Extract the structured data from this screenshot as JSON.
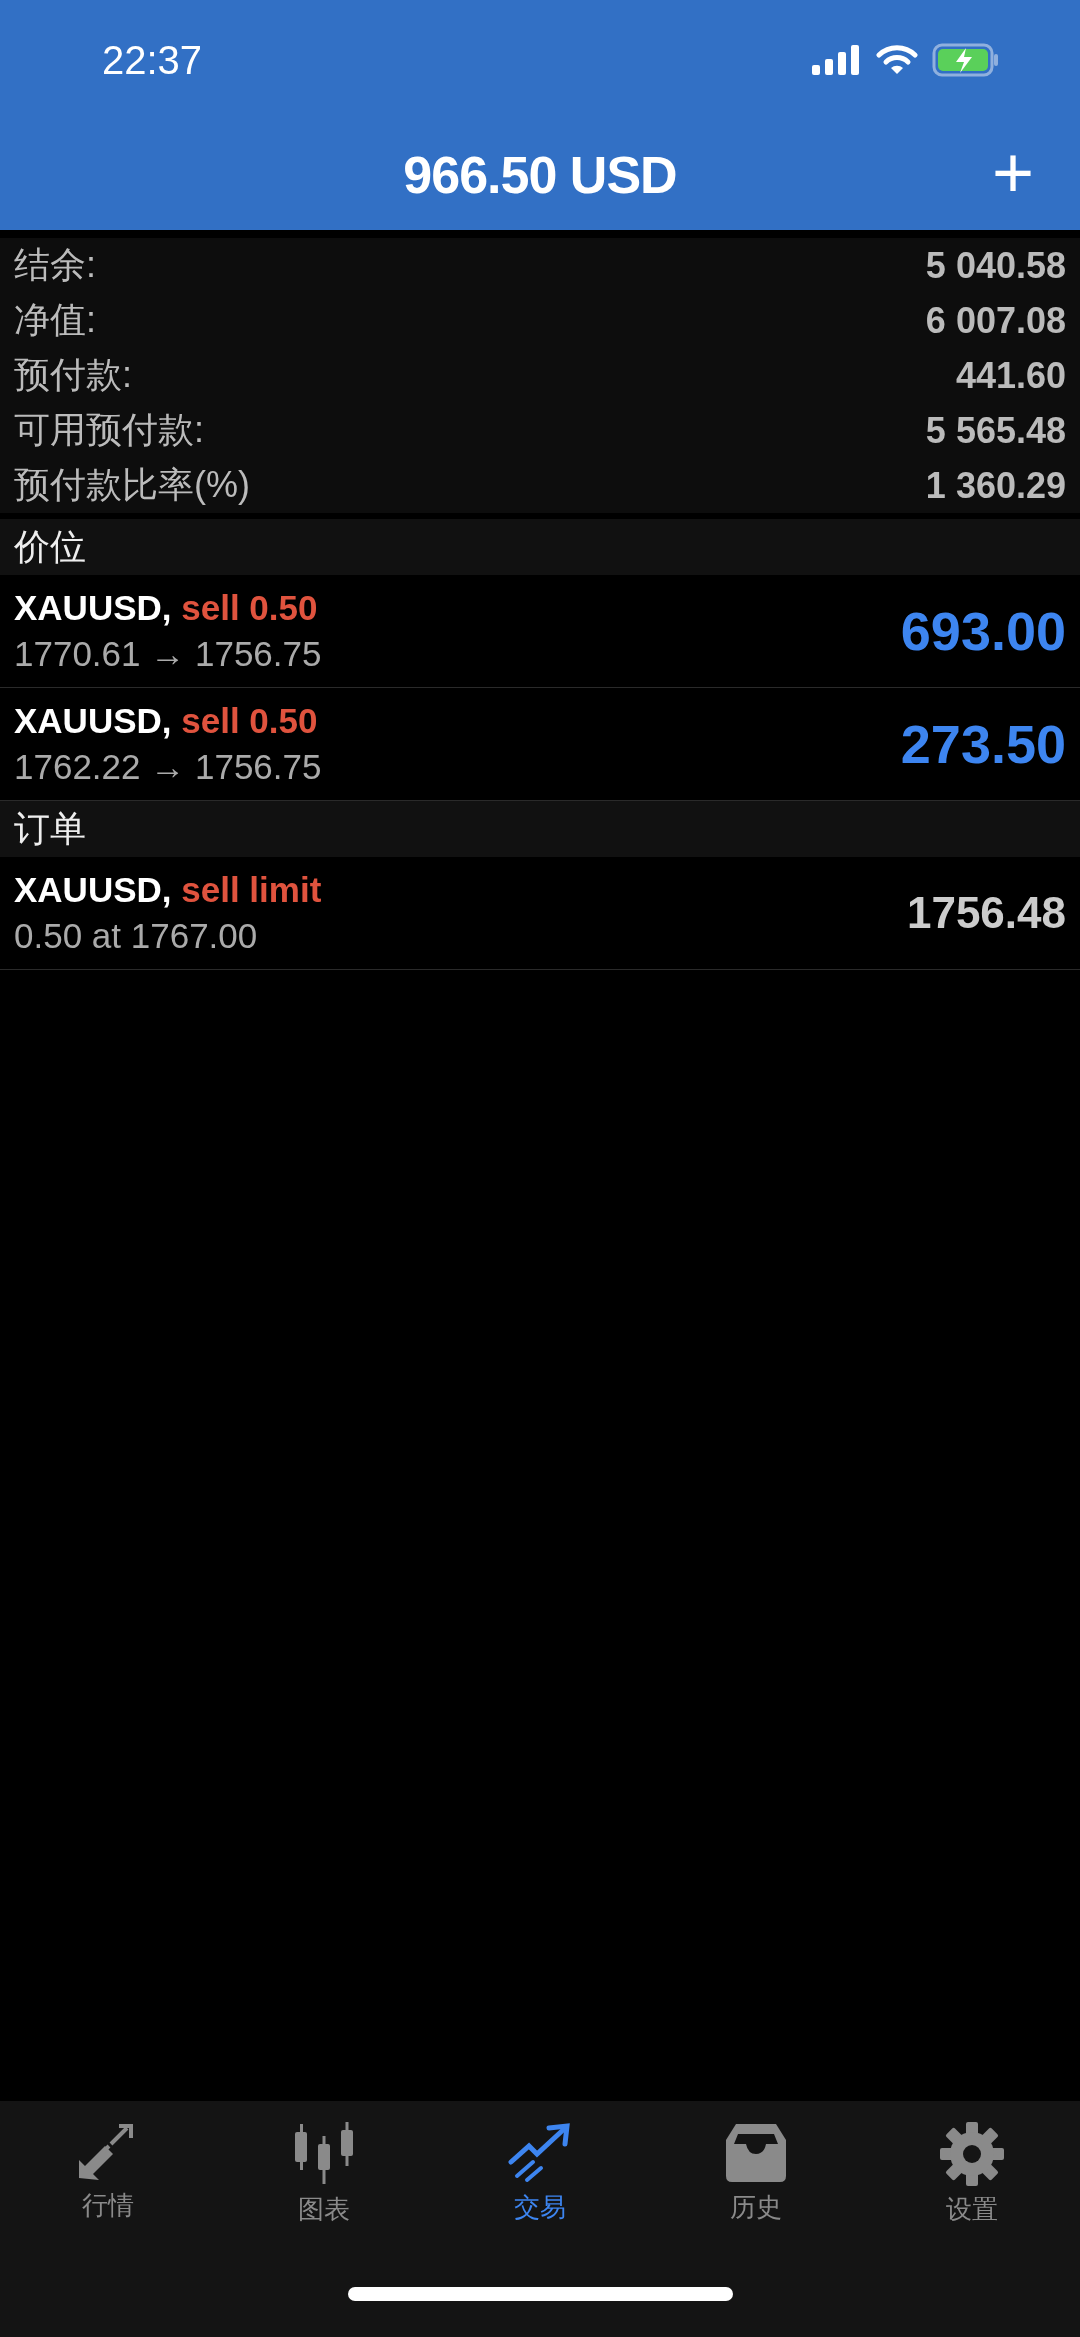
{
  "status_bar": {
    "time": "22:37"
  },
  "header": {
    "title": "966.50 USD",
    "action": "+"
  },
  "summary": [
    {
      "label": "结余:",
      "value": "5 040.58"
    },
    {
      "label": "净值:",
      "value": "6 007.08"
    },
    {
      "label": "预付款:",
      "value": "441.60"
    },
    {
      "label": "可用预付款:",
      "value": "5 565.48"
    },
    {
      "label": "预付款比率(%)",
      "value": "1 360.29"
    }
  ],
  "sections": [
    {
      "title": "价位",
      "rows": [
        {
          "kind": "position",
          "symbol": "XAUUSD,",
          "side": "sell 0.50",
          "detail": "1770.61 → 1756.75",
          "amount": "693.00"
        },
        {
          "kind": "position",
          "symbol": "XAUUSD,",
          "side": "sell 0.50",
          "detail": "1762.22 → 1756.75",
          "amount": "273.50"
        }
      ]
    },
    {
      "title": "订单",
      "rows": [
        {
          "kind": "order",
          "symbol": "XAUUSD,",
          "side": "sell limit",
          "detail": "0.50 at 1767.00",
          "amount": "1756.48"
        }
      ]
    }
  ],
  "tabs": [
    {
      "label": "行情",
      "selected": false
    },
    {
      "label": "图表",
      "selected": false
    },
    {
      "label": "交易",
      "selected": true
    },
    {
      "label": "历史",
      "selected": false
    },
    {
      "label": "设置",
      "selected": false
    }
  ]
}
